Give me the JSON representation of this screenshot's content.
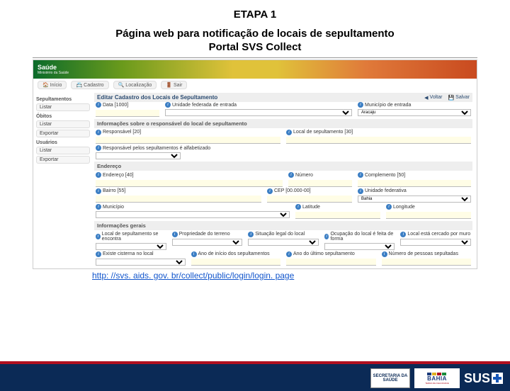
{
  "slide": {
    "step": "ETAPA 1",
    "title": "Página web para notificação de locais de sepultamento",
    "subtitle": "Portal SVS Collect",
    "link": "http: //svs. aids. gov. br/collect/public/login/login. page"
  },
  "banner": {
    "title": "Saúde",
    "sub": "Ministério da Saúde"
  },
  "tabs": [
    {
      "icon": "🏠",
      "label": "Início"
    },
    {
      "icon": "📇",
      "label": "Cadastro"
    },
    {
      "icon": "🔍",
      "label": "Localização"
    },
    {
      "icon": "🚪",
      "label": "Sair"
    }
  ],
  "sidebar": {
    "groups": [
      {
        "head": "Sepultamentos",
        "items": [
          "Listar"
        ]
      },
      {
        "head": "Óbitos",
        "items": [
          "Listar",
          "Exportar"
        ]
      },
      {
        "head": "Usuários",
        "items": [
          "Listar",
          "Exportar"
        ]
      }
    ]
  },
  "panel": {
    "title": "Editar Cadastro dos Locais de Sepultamento",
    "actions": {
      "back": "Voltar",
      "save": "Salvar"
    }
  },
  "rows": {
    "r1": {
      "data": "Data [1000]",
      "uf": "Unidade federada de entrada",
      "mun": "Município de entrada",
      "mun_val": "Aracaju"
    },
    "sec_resp": "Informações sobre o responsável do local de sepultamento",
    "r2": {
      "resp": "Responsável [20]",
      "local": "Local de sepultamento [30]"
    },
    "r3": {
      "alf": "Responsável pelos sepultamentos é alfabetizado"
    },
    "sec_end": "Endereço",
    "r4": {
      "end": "Endereço [40]",
      "num": "Número",
      "comp": "Complemento [50]"
    },
    "r5": {
      "bairro": "Bairro [55]",
      "cep": "CEP [00.000-00]",
      "uf2": "Unidade federativa",
      "uf2_val": "Bahia"
    },
    "r6": {
      "mun2": "Município",
      "lat": "Latitude",
      "lon": "Longitude"
    },
    "sec_ger": "Informações gerais",
    "r7": {
      "a": "Local de sepultamento se encontra",
      "b": "Propriedade do terreno",
      "c": "Situação legal do local",
      "d": "Ocupação do local é feita de forma",
      "e": "Local está cercado por muro"
    },
    "r8": {
      "a": "Existe cisterna no local",
      "b": "Ano de início dos sepultamentos",
      "c": "Ano do último sepultamento",
      "d": "Número de pessoas sepultadas"
    }
  },
  "footer": {
    "box1": "SECRETARIA DA SAÚDE",
    "bahia": "BAHIA",
    "bahia_sub": "TERRA DE FELICIDADE",
    "sus": "SUS"
  }
}
